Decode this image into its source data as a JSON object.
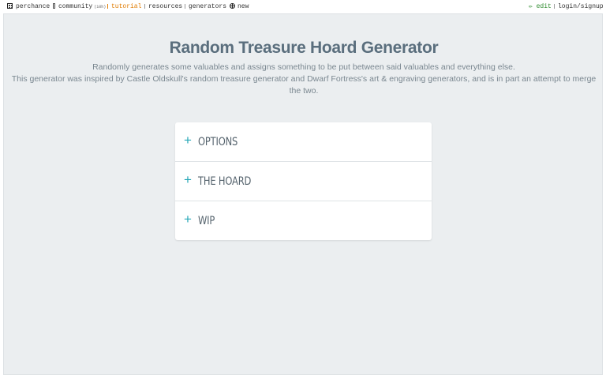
{
  "nav": {
    "brand": "perchance",
    "community": "community",
    "community_badge": "(10h)",
    "tutorial": "tutorial",
    "resources": "resources",
    "generators": "generators",
    "new": "new",
    "edit": "✏ edit",
    "login": "login/signup"
  },
  "page": {
    "title": "Random Treasure Hoard Generator",
    "description_line1": "Randomly generates some valuables and assigns something to be put between said valuables and everything else.",
    "description_line2": "This generator was inspired by Castle Oldskull's random treasure generator and Dwarf Fortress's art & engraving generators, and is in part an attempt to merge the two."
  },
  "accordion": {
    "items": [
      {
        "icon": "+",
        "label": "OPTIONS"
      },
      {
        "icon": "+",
        "label": "THE HOARD"
      },
      {
        "icon": "+",
        "label": "WIP"
      }
    ]
  },
  "colors": {
    "accent": "#28a8b8",
    "panel_bg": "#ebeef0",
    "title": "#5a6e7d",
    "tutorial": "#e07b00",
    "edit": "#2e8b2e"
  }
}
